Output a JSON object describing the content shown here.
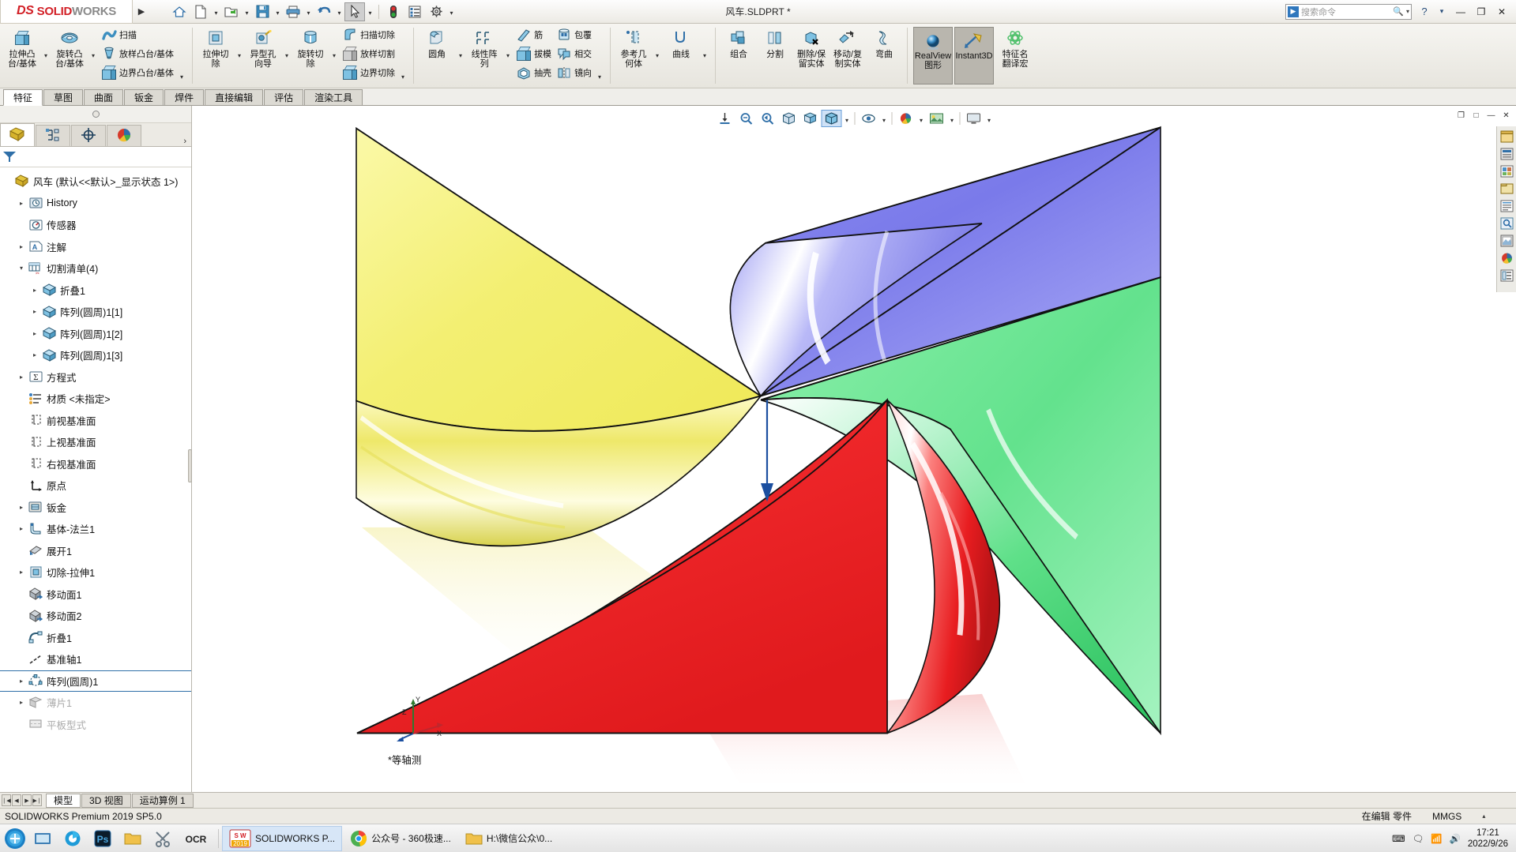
{
  "titlebar": {
    "logo_ds": "DS",
    "logo_solid": "SOLID",
    "logo_works": "WORKS",
    "expand_arrow": "▶",
    "document_title": "风车.SLDPRT *",
    "quick_access": [
      {
        "name": "home-icon",
        "label": "首页",
        "caret": false
      },
      {
        "name": "new-document-icon",
        "label": "新建",
        "caret": true
      },
      {
        "name": "open-folder-icon",
        "label": "打开",
        "caret": true
      },
      {
        "name": "save-icon",
        "label": "保存",
        "caret": true
      },
      {
        "name": "print-icon",
        "label": "打印",
        "caret": true
      },
      {
        "name": "undo-icon",
        "label": "撤销",
        "caret": true
      },
      {
        "name": "select-cursor-icon",
        "label": "选择",
        "caret": true
      },
      {
        "name": "rebuild-icon",
        "label": "重建模型",
        "caret": false
      },
      {
        "name": "options-list-icon",
        "label": "文件属性",
        "caret": false
      },
      {
        "name": "gear-icon",
        "label": "选项",
        "caret": true
      }
    ],
    "search": {
      "placeholder": "搜索命令",
      "icon": "search-icon"
    },
    "right_icons": [
      "help-icon",
      "chevron-down-icon"
    ],
    "window_buttons": {
      "minimize": "—",
      "maximize": "❐",
      "close": "✕"
    }
  },
  "ribbon": {
    "groups": [
      {
        "name": "boss-base-group",
        "big": [
          {
            "label": "拉伸凸\n台/基体",
            "icon": "extruded-boss-icon"
          },
          {
            "label": "旋转凸\n台/基体",
            "icon": "revolved-boss-icon"
          }
        ],
        "small": [
          {
            "label": "扫描",
            "icon": "swept-boss-icon"
          },
          {
            "label": "放样凸台/基体",
            "icon": "lofted-boss-icon"
          },
          {
            "label": "边界凸台/基体",
            "icon": "boundary-boss-icon"
          }
        ]
      },
      {
        "name": "cut-group",
        "big": [
          {
            "label": "拉伸切\n除",
            "icon": "extruded-cut-icon"
          },
          {
            "label": "异型孔\n向导",
            "icon": "hole-wizard-icon"
          },
          {
            "label": "旋转切\n除",
            "icon": "revolved-cut-icon"
          }
        ],
        "small": [
          {
            "label": "扫描切除",
            "icon": "swept-cut-icon"
          },
          {
            "label": "放样切割",
            "icon": "lofted-cut-icon"
          },
          {
            "label": "边界切除",
            "icon": "boundary-cut-icon"
          }
        ]
      },
      {
        "name": "features-group",
        "big": [
          {
            "label": "圆角",
            "icon": "fillet-icon"
          },
          {
            "label": "线性阵\n列",
            "icon": "linear-pattern-icon"
          }
        ],
        "small": [
          {
            "label": "筋",
            "icon": "rib-icon"
          },
          {
            "label": "拔模",
            "icon": "draft-icon"
          },
          {
            "label": "抽壳",
            "icon": "shell-icon"
          }
        ],
        "small2": [
          {
            "label": "包覆",
            "icon": "wrap-icon"
          },
          {
            "label": "相交",
            "icon": "intersect-icon"
          },
          {
            "label": "镜向",
            "icon": "mirror-icon"
          }
        ]
      },
      {
        "name": "reference-group",
        "big": [
          {
            "label": "参考几\n何体",
            "icon": "reference-geometry-icon"
          },
          {
            "label": "曲线",
            "icon": "curves-icon"
          }
        ]
      },
      {
        "name": "bodies-group",
        "big": [
          {
            "label": "组合",
            "icon": "combine-icon"
          },
          {
            "label": "分割",
            "icon": "split-icon"
          },
          {
            "label": "删除/保\n留实体",
            "icon": "delete-keep-body-icon"
          },
          {
            "label": "移动/复\n制实体",
            "icon": "move-copy-body-icon"
          },
          {
            "label": "弯曲",
            "icon": "flex-icon"
          }
        ]
      },
      {
        "name": "display-group",
        "toggles": [
          {
            "label": "RealView\n图形",
            "icon": "realview-icon",
            "active": true
          },
          {
            "label": "Instant3D",
            "icon": "instant3d-icon",
            "active": true
          }
        ],
        "big": [
          {
            "label": "特征名\n翻译宏",
            "icon": "macro-icon"
          }
        ]
      }
    ]
  },
  "ribbon_tabs": [
    {
      "label": "特征",
      "active": true
    },
    {
      "label": "草图",
      "active": false
    },
    {
      "label": "曲面",
      "active": false
    },
    {
      "label": "钣金",
      "active": false
    },
    {
      "label": "焊件",
      "active": false
    },
    {
      "label": "直接编辑",
      "active": false
    },
    {
      "label": "评估",
      "active": false
    },
    {
      "label": "渲染工具",
      "active": false
    }
  ],
  "left_panel": {
    "tabs": [
      {
        "name": "feature-manager-tab",
        "icon": "feature-tree-icon",
        "active": true
      },
      {
        "name": "property-manager-tab",
        "icon": "property-manager-icon",
        "active": false
      },
      {
        "name": "configuration-manager-tab",
        "icon": "configuration-icon",
        "active": false
      },
      {
        "name": "display-manager-tab",
        "icon": "appearance-sphere-icon",
        "active": false
      }
    ],
    "more_arrow": "›",
    "filter_placeholder": "",
    "tree": [
      {
        "label": "风车  (默认<<默认>_显示状态 1>)",
        "indent": 0,
        "expand": "",
        "icon": "part-icon",
        "selected": false
      },
      {
        "label": "History",
        "indent": 1,
        "expand": "▸",
        "icon": "history-icon",
        "selected": false
      },
      {
        "label": "传感器",
        "indent": 1,
        "expand": "",
        "icon": "sensor-icon",
        "selected": false
      },
      {
        "label": "注解",
        "indent": 1,
        "expand": "▸",
        "icon": "annotations-icon",
        "selected": false
      },
      {
        "label": "切割清单(4)",
        "indent": 1,
        "expand": "▾",
        "icon": "cutlist-icon",
        "selected": false
      },
      {
        "label": "折叠1",
        "indent": 2,
        "expand": "▸",
        "icon": "solid-body-icon",
        "selected": false
      },
      {
        "label": "阵列(圆周)1[1]",
        "indent": 2,
        "expand": "▸",
        "icon": "solid-body-icon",
        "selected": false
      },
      {
        "label": "阵列(圆周)1[2]",
        "indent": 2,
        "expand": "▸",
        "icon": "solid-body-icon",
        "selected": false
      },
      {
        "label": "阵列(圆周)1[3]",
        "indent": 2,
        "expand": "▸",
        "icon": "solid-body-icon",
        "selected": false
      },
      {
        "label": "方程式",
        "indent": 1,
        "expand": "▸",
        "icon": "equations-icon",
        "selected": false
      },
      {
        "label": "材质 <未指定>",
        "indent": 1,
        "expand": "",
        "icon": "material-icon",
        "selected": false
      },
      {
        "label": "前视基准面",
        "indent": 1,
        "expand": "",
        "icon": "plane-icon",
        "selected": false
      },
      {
        "label": "上视基准面",
        "indent": 1,
        "expand": "",
        "icon": "plane-icon",
        "selected": false
      },
      {
        "label": "右视基准面",
        "indent": 1,
        "expand": "",
        "icon": "plane-icon",
        "selected": false
      },
      {
        "label": "原点",
        "indent": 1,
        "expand": "",
        "icon": "origin-icon",
        "selected": false
      },
      {
        "label": "钣金",
        "indent": 1,
        "expand": "▸",
        "icon": "sheetmetal-icon",
        "selected": false
      },
      {
        "label": "基体-法兰1",
        "indent": 1,
        "expand": "▸",
        "icon": "base-flange-icon",
        "selected": false
      },
      {
        "label": "展开1",
        "indent": 1,
        "expand": "",
        "icon": "flatten-icon",
        "selected": false
      },
      {
        "label": "切除-拉伸1",
        "indent": 1,
        "expand": "▸",
        "icon": "extruded-cut-icon",
        "selected": false
      },
      {
        "label": "移动面1",
        "indent": 1,
        "expand": "",
        "icon": "move-face-icon",
        "selected": false
      },
      {
        "label": "移动面2",
        "indent": 1,
        "expand": "",
        "icon": "move-face-icon",
        "selected": false
      },
      {
        "label": "折叠1",
        "indent": 1,
        "expand": "",
        "icon": "fold-icon",
        "selected": false
      },
      {
        "label": "基准轴1",
        "indent": 1,
        "expand": "",
        "icon": "axis-icon",
        "selected": false
      },
      {
        "label": "阵列(圆周)1",
        "indent": 1,
        "expand": "▸",
        "icon": "circular-pattern-icon",
        "selected": true
      },
      {
        "label": "薄片1",
        "indent": 1,
        "expand": "▸",
        "icon": "sheet-icon",
        "selected": false,
        "dim": true
      },
      {
        "label": "平板型式",
        "indent": 1,
        "expand": "",
        "icon": "flat-pattern-icon",
        "selected": false,
        "dim": true
      }
    ]
  },
  "view_toolbar": {
    "buttons": [
      {
        "name": "zoom-to-fit-icon",
        "caret": false
      },
      {
        "name": "zoom-to-area-icon",
        "caret": false
      },
      {
        "name": "previous-view-icon",
        "caret": false
      },
      {
        "name": "section-view-icon",
        "caret": false
      },
      {
        "name": "view-orientation-icon",
        "caret": false
      },
      {
        "name": "display-style-icon",
        "caret": true,
        "selected": true
      },
      {
        "name": "hide-show-items-icon",
        "caret": true
      },
      {
        "name": "edit-appearance-icon",
        "caret": true
      },
      {
        "name": "apply-scene-icon",
        "caret": true
      },
      {
        "name": "view-settings-icon",
        "caret": true
      }
    ]
  },
  "right_toolbar": {
    "buttons": [
      {
        "name": "view-palette-icon"
      },
      {
        "name": "appearances-icon"
      },
      {
        "name": "scenes-icon"
      },
      {
        "name": "design-library-icon"
      },
      {
        "name": "file-explorer-icon"
      },
      {
        "name": "search-library-icon"
      },
      {
        "name": "view-palette2-icon"
      },
      {
        "name": "appearance-sphere-icon"
      },
      {
        "name": "custom-properties-icon"
      }
    ]
  },
  "graphics": {
    "view_label": "*等轴测",
    "triad": {
      "x": "X",
      "y": "Y",
      "z": "Z"
    },
    "model": {
      "name": "pinwheel",
      "blades": [
        {
          "name": "yellow-blade",
          "color": "#f2ef7a"
        },
        {
          "name": "blue-blade",
          "color": "#7d7ded"
        },
        {
          "name": "green-blade",
          "color": "#6ce695"
        },
        {
          "name": "red-blade",
          "color": "#f0282b"
        }
      ]
    },
    "window_buttons": {
      "restore_small": "❐",
      "minimize": "—",
      "maximize": "□",
      "close": "✕"
    }
  },
  "bottom_tabs": {
    "nav": [
      "❘◀",
      "◀",
      "▶",
      "▶❘"
    ],
    "tabs": [
      {
        "label": "模型",
        "active": true
      },
      {
        "label": "3D 视图",
        "active": false
      },
      {
        "label": "运动算例 1",
        "active": false
      }
    ]
  },
  "status_bar": {
    "left": "SOLIDWORKS Premium 2019 SP5.0",
    "editing": "在编辑 零件",
    "units": "MMGS",
    "caret": "▴"
  },
  "taskbar": {
    "start": "start-orb-icon",
    "pinned": [
      {
        "name": "file-explorer-icon",
        "label": ""
      },
      {
        "name": "browser-icon",
        "label": ""
      },
      {
        "name": "photoshop-icon",
        "label": "Ps"
      },
      {
        "name": "folder-yellow-icon",
        "label": ""
      },
      {
        "name": "snipping-tool-icon",
        "label": ""
      },
      {
        "name": "ocr-tool-icon",
        "label": "OCR"
      }
    ],
    "windows": [
      {
        "name": "solidworks-window",
        "label": "SOLIDWORKS P...",
        "icon": "solidworks-taskbar-icon",
        "active": true
      },
      {
        "name": "chrome-window",
        "label": "公众号 - 360极速...",
        "icon": "chrome-icon",
        "active": false
      },
      {
        "name": "explorer-window",
        "label": "H:\\微信公众\\0...",
        "icon": "folder-icon",
        "active": false
      }
    ],
    "tray": {
      "icons": [
        "keyboard-icon",
        "notify-icon",
        "network-icon",
        "volume-icon",
        "battery-icon"
      ],
      "time": "17:21",
      "date": "2022/9/26"
    }
  }
}
